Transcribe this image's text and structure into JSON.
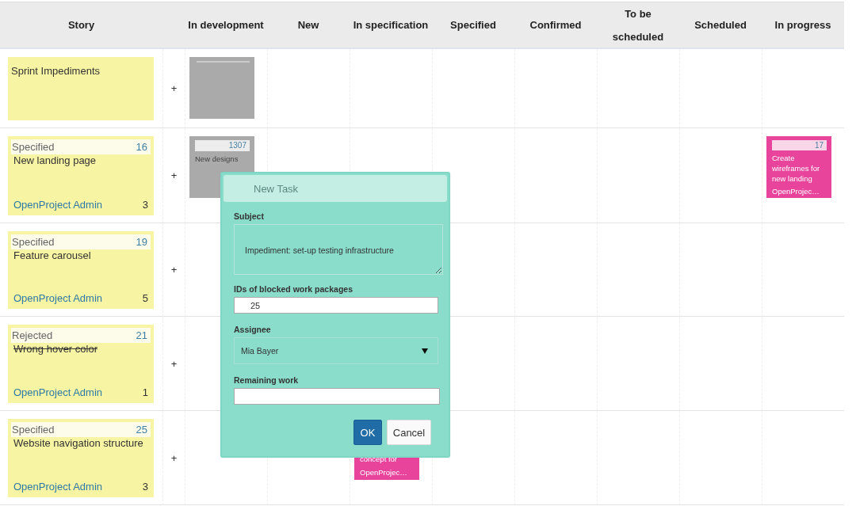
{
  "columns": [
    "Story",
    "",
    "In development",
    "New",
    "In specification",
    "Specified",
    "Confirmed",
    "To be scheduled",
    "Scheduled",
    "In progress"
  ],
  "rows": [
    {
      "story": {
        "kind": "impediments",
        "title": "Sprint Impediments"
      },
      "add": "+",
      "cells": [
        {
          "tasks": [
            {
              "kind": "blank",
              "color": "#aaaaaa"
            }
          ]
        },
        null,
        null,
        null,
        null,
        null,
        null,
        null
      ]
    },
    {
      "story": {
        "kind": "story",
        "status": "Specified",
        "id": "16",
        "title": "New landing page",
        "closed": false,
        "assignee": "OpenProject Admin",
        "points": "3"
      },
      "add": "+",
      "cells": [
        {
          "tasks": [
            {
              "kind": "full",
              "color": "#aaaaaa",
              "id": "1307",
              "lines": [
                "New designs"
              ]
            }
          ]
        },
        null,
        null,
        null,
        null,
        null,
        null,
        {
          "tasks": [
            {
              "kind": "full",
              "color": "#e8449c",
              "id": "17",
              "lines": [
                "Create wireframes for new landing",
                "OpenProjec…"
              ]
            }
          ]
        }
      ]
    },
    {
      "story": {
        "kind": "story",
        "status": "Specified",
        "id": "19",
        "title": "Feature carousel",
        "closed": false,
        "assignee": "OpenProject Admin",
        "points": "5"
      },
      "add": "+"
    },
    {
      "story": {
        "kind": "story",
        "status": "Rejected",
        "id": "21",
        "title": "Wrong hover color",
        "closed": true,
        "assignee": "OpenProject Admin",
        "points": "1"
      },
      "add": "+"
    },
    {
      "story": {
        "kind": "story",
        "status": "Specified",
        "id": "25",
        "title": "Website navigation structure",
        "closed": false,
        "assignee": "OpenProject Admin",
        "points": "3"
      },
      "add": "+",
      "cells": [
        null,
        null,
        {
          "tasks": [
            {
              "kind": "covered",
              "color": "#e8449c",
              "lines": [
                "concept for",
                "OpenProjec…"
              ]
            }
          ]
        },
        null,
        null,
        null,
        null,
        null
      ]
    }
  ],
  "dialog": {
    "title": "New Task",
    "fields": [
      {
        "kind": "textarea",
        "label": "Subject",
        "value": "Impediment: set-up testing infrastructure"
      },
      {
        "kind": "input",
        "label": "IDs of blocked work packages",
        "value": "25"
      },
      {
        "kind": "select",
        "label": "Assignee",
        "value": "Mia Bayer"
      },
      {
        "kind": "text",
        "label": "Remaining work"
      }
    ],
    "buttons": [
      {
        "label": "OK",
        "primary": true
      },
      {
        "label": "Cancel",
        "primary": false
      }
    ]
  }
}
